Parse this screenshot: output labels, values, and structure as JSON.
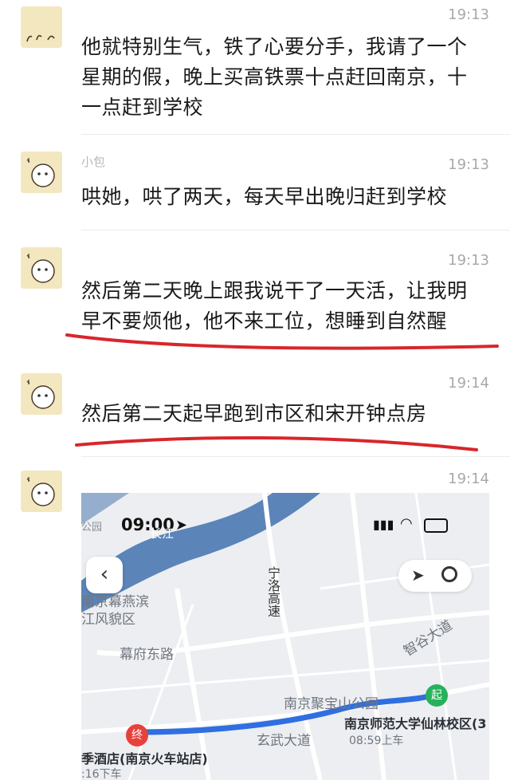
{
  "messages": [
    {
      "sender": "",
      "time": "19:13",
      "lines": [
        "他就特别生气，铁了心要分手，我请了一个",
        "星期的假，晚上买高铁票十点赶回南京，十",
        "一点赶到学校"
      ]
    },
    {
      "sender": "小包",
      "time": "19:13",
      "lines": [
        "哄她，哄了两天，每天早出晚归赶到学校"
      ]
    },
    {
      "sender": "",
      "time": "19:13",
      "lines": [
        "然后第二天晚上跟我说干了一天活，让我明",
        "早不要烦他，他不来工位，想睡到自然醒"
      ]
    },
    {
      "sender": "",
      "time": "19:14",
      "lines": [
        "然后第二天起早跑到市区和宋开钟点房"
      ]
    },
    {
      "sender": "",
      "time": "19:14",
      "lines": []
    }
  ],
  "map": {
    "status_time": "09:00",
    "corner_label": "公园",
    "river_label": "长江",
    "labels": {
      "highway": "宁洛高速",
      "district": "南京幕燕滨江风貌区",
      "road1": "幕府东路",
      "road2": "智谷大道",
      "park": "南京聚宝山公园",
      "avenue": "玄武大道",
      "start_name": "南京师范大学仙林校区(3",
      "start_time": "08:59上车",
      "end_name": "季酒店(南京火车站店)",
      "end_time": ":16下车"
    },
    "pin_start": "起",
    "pin_end": "终",
    "back_icon": "‹"
  },
  "colors": {
    "underline": "#d8262b",
    "route": "#2f6fe0",
    "water": "#5b84b8"
  }
}
